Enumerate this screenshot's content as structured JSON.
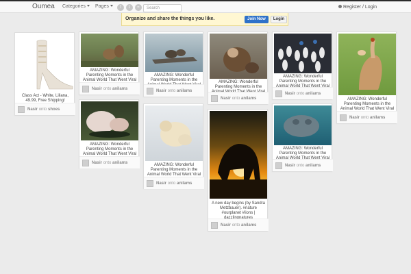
{
  "header": {
    "brand": "Oumea",
    "categories_label": "Categories",
    "pages_label": "Pages",
    "social_icons": [
      "facebook-icon",
      "twitter-icon",
      "rss-icon"
    ],
    "search_placeholder": "Search",
    "register_login": "Register / Login"
  },
  "banner": {
    "text": "Organize and share the things you like.",
    "join_label": "Join Now",
    "login_label": "Login"
  },
  "byline": {
    "onto": "onto"
  },
  "pins": [
    {
      "caption": "Class Act - White, Liliana, 49.99, Free Shipping!",
      "user": "Nasir",
      "board": "shoes"
    },
    {
      "caption": "AMAZING: Wonderful Parenting Moments in the Animal World That Went Viral",
      "user": "Nasir",
      "board": "anilams"
    },
    {
      "caption": "AMAZING: Wonderful Parenting Moments in the Animal World That Went Viral",
      "user": "Nasir",
      "board": "anilams"
    },
    {
      "caption": "AMAZING: Wonderful Parenting Moments in the Animal World That Went Viral",
      "user": "Nasir",
      "board": "anilams"
    },
    {
      "caption": "AMAZING: Wonderful Parenting Moments in the Animal World That Went Viral",
      "user": "Nasir",
      "board": "anilams"
    },
    {
      "caption": "AMAZING: Wonderful Parenting Moments in the Animal World That Went Viral",
      "user": "Nasir",
      "board": "anilams"
    },
    {
      "caption": "AMAZING: Wonderful Parenting Moments in the Animal World That Went Viral",
      "user": "Nasir",
      "board": "anilams"
    },
    {
      "caption": "AMAZING: Wonderful Parenting Moments in the Animal World That Went Viral",
      "user": "Nasir",
      "board": "anilams"
    },
    {
      "caption": "A new day begins (by Sandra Metzbauer). #nature #ourplanet #lions | dazzlingnatures",
      "user": "Nasir",
      "board": "anilams"
    },
    {
      "caption": "AMAZING: Wonderful Parenting Moments in the Animal World That Went Viral",
      "user": "Nasir",
      "board": "anilams"
    }
  ]
}
